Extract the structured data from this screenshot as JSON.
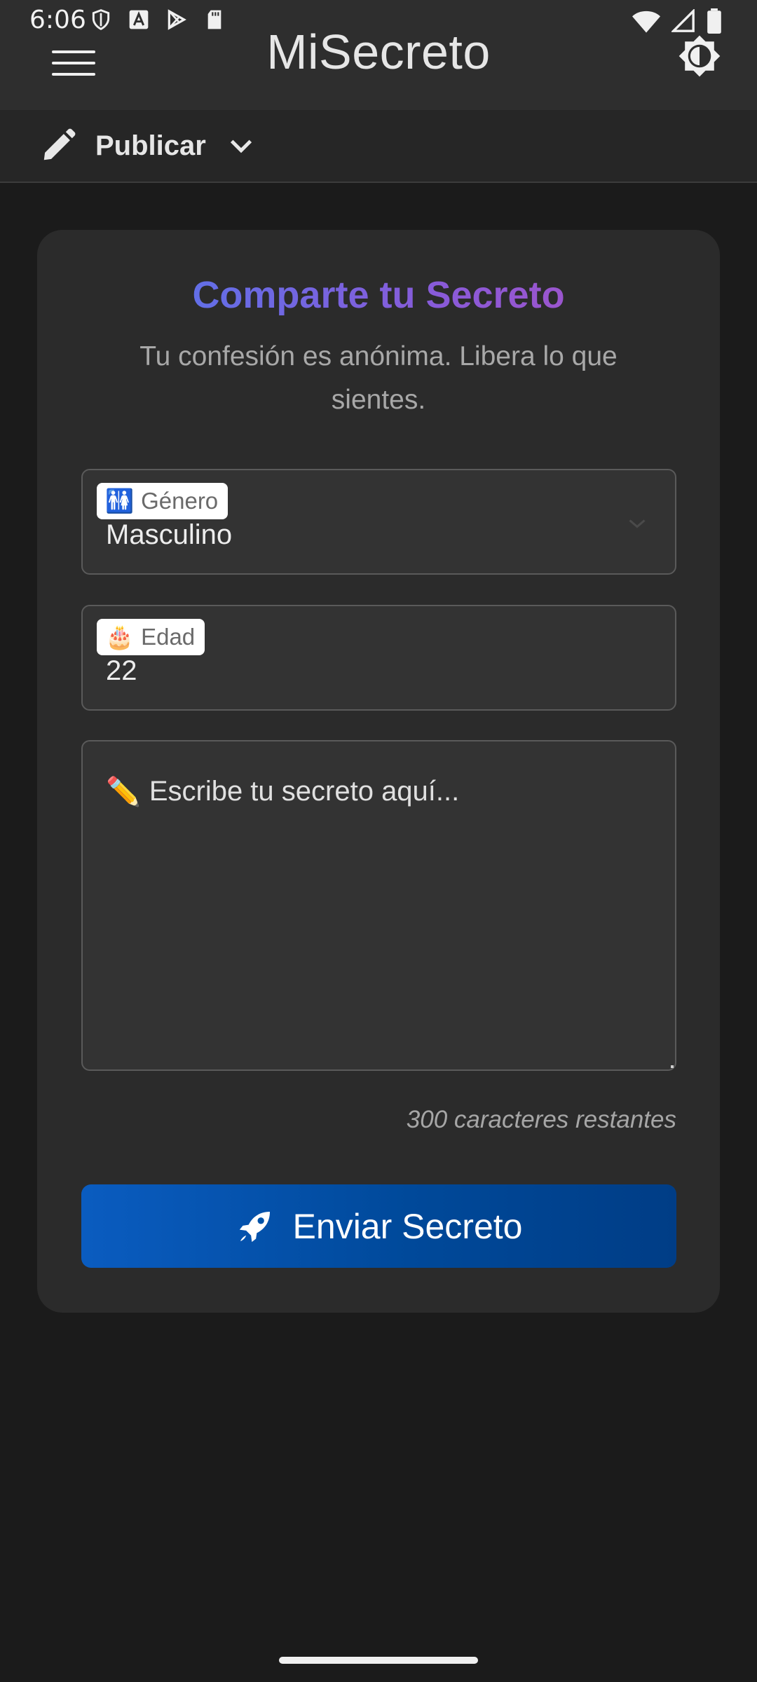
{
  "status_bar": {
    "time": "6:06",
    "left_icons": [
      "shield-icon",
      "font-a-icon",
      "play-store-icon",
      "sd-card-icon"
    ],
    "right_icons": [
      "wifi-icon",
      "signal-icon",
      "battery-icon"
    ]
  },
  "header": {
    "title": "MiSecreto",
    "menu_icon": "hamburger-icon",
    "theme_icon": "brightness-icon"
  },
  "subbar": {
    "label": "Publicar",
    "icon": "pencil-icon"
  },
  "form": {
    "title": "Comparte tu Secreto",
    "subtitle": "Tu confesión es anónima. Libera lo que sientes.",
    "gender": {
      "emoji": "🚻",
      "label": "Género",
      "value": "Masculino"
    },
    "age": {
      "emoji": "🎂",
      "label": "Edad",
      "value": "22"
    },
    "secret": {
      "emoji": "✏️",
      "placeholder": "Escribe tu secreto aquí..."
    },
    "counter": "300 caracteres restantes",
    "submit_label": "Enviar Secreto"
  },
  "colors": {
    "background": "#1b1b1b",
    "card": "#2b2b2b",
    "button": "#0a5cc0",
    "title_gradient_start": "#4a7bf0",
    "title_gradient_end": "#b04fc0"
  }
}
